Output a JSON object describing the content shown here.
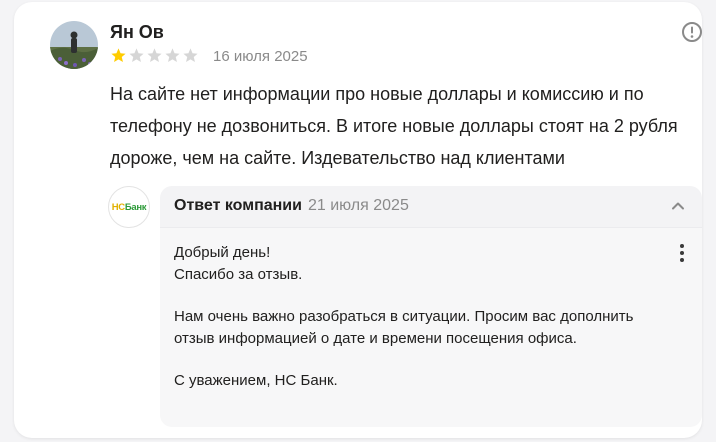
{
  "review": {
    "author": "Ян Ов",
    "rating": 1,
    "max_rating": 5,
    "date": "16 июля 2025",
    "text": "На сайте нет информации про новые доллары и комиссию и по телефону не дозвониться. В итоге новые доллары стоят на 2 рубля дороже, чем на сайте. Издевательство над клиентами",
    "report_icon": "exclamation-circle-icon"
  },
  "reply": {
    "company_logo": {
      "part1": "НС",
      "part2": "Банк"
    },
    "title": "Ответ компании",
    "date": "21 июля 2025",
    "collapse_icon": "chevron-up-icon",
    "menu_icon": "more-vertical-icon",
    "lines": {
      "l1": "Добрый день!",
      "l2": "Спасибо за отзыв.",
      "l3": "Нам очень важно разобраться в ситуации. Просим вас дополнить отзыв информацией о дате и времени посещения офиса.",
      "l4": "С уважением, НС Банк."
    }
  },
  "colors": {
    "star_filled": "#fc0",
    "star_empty": "#d6d6d6",
    "brand_yellow": "#e1b100",
    "brand_green": "#2e9b3a"
  }
}
